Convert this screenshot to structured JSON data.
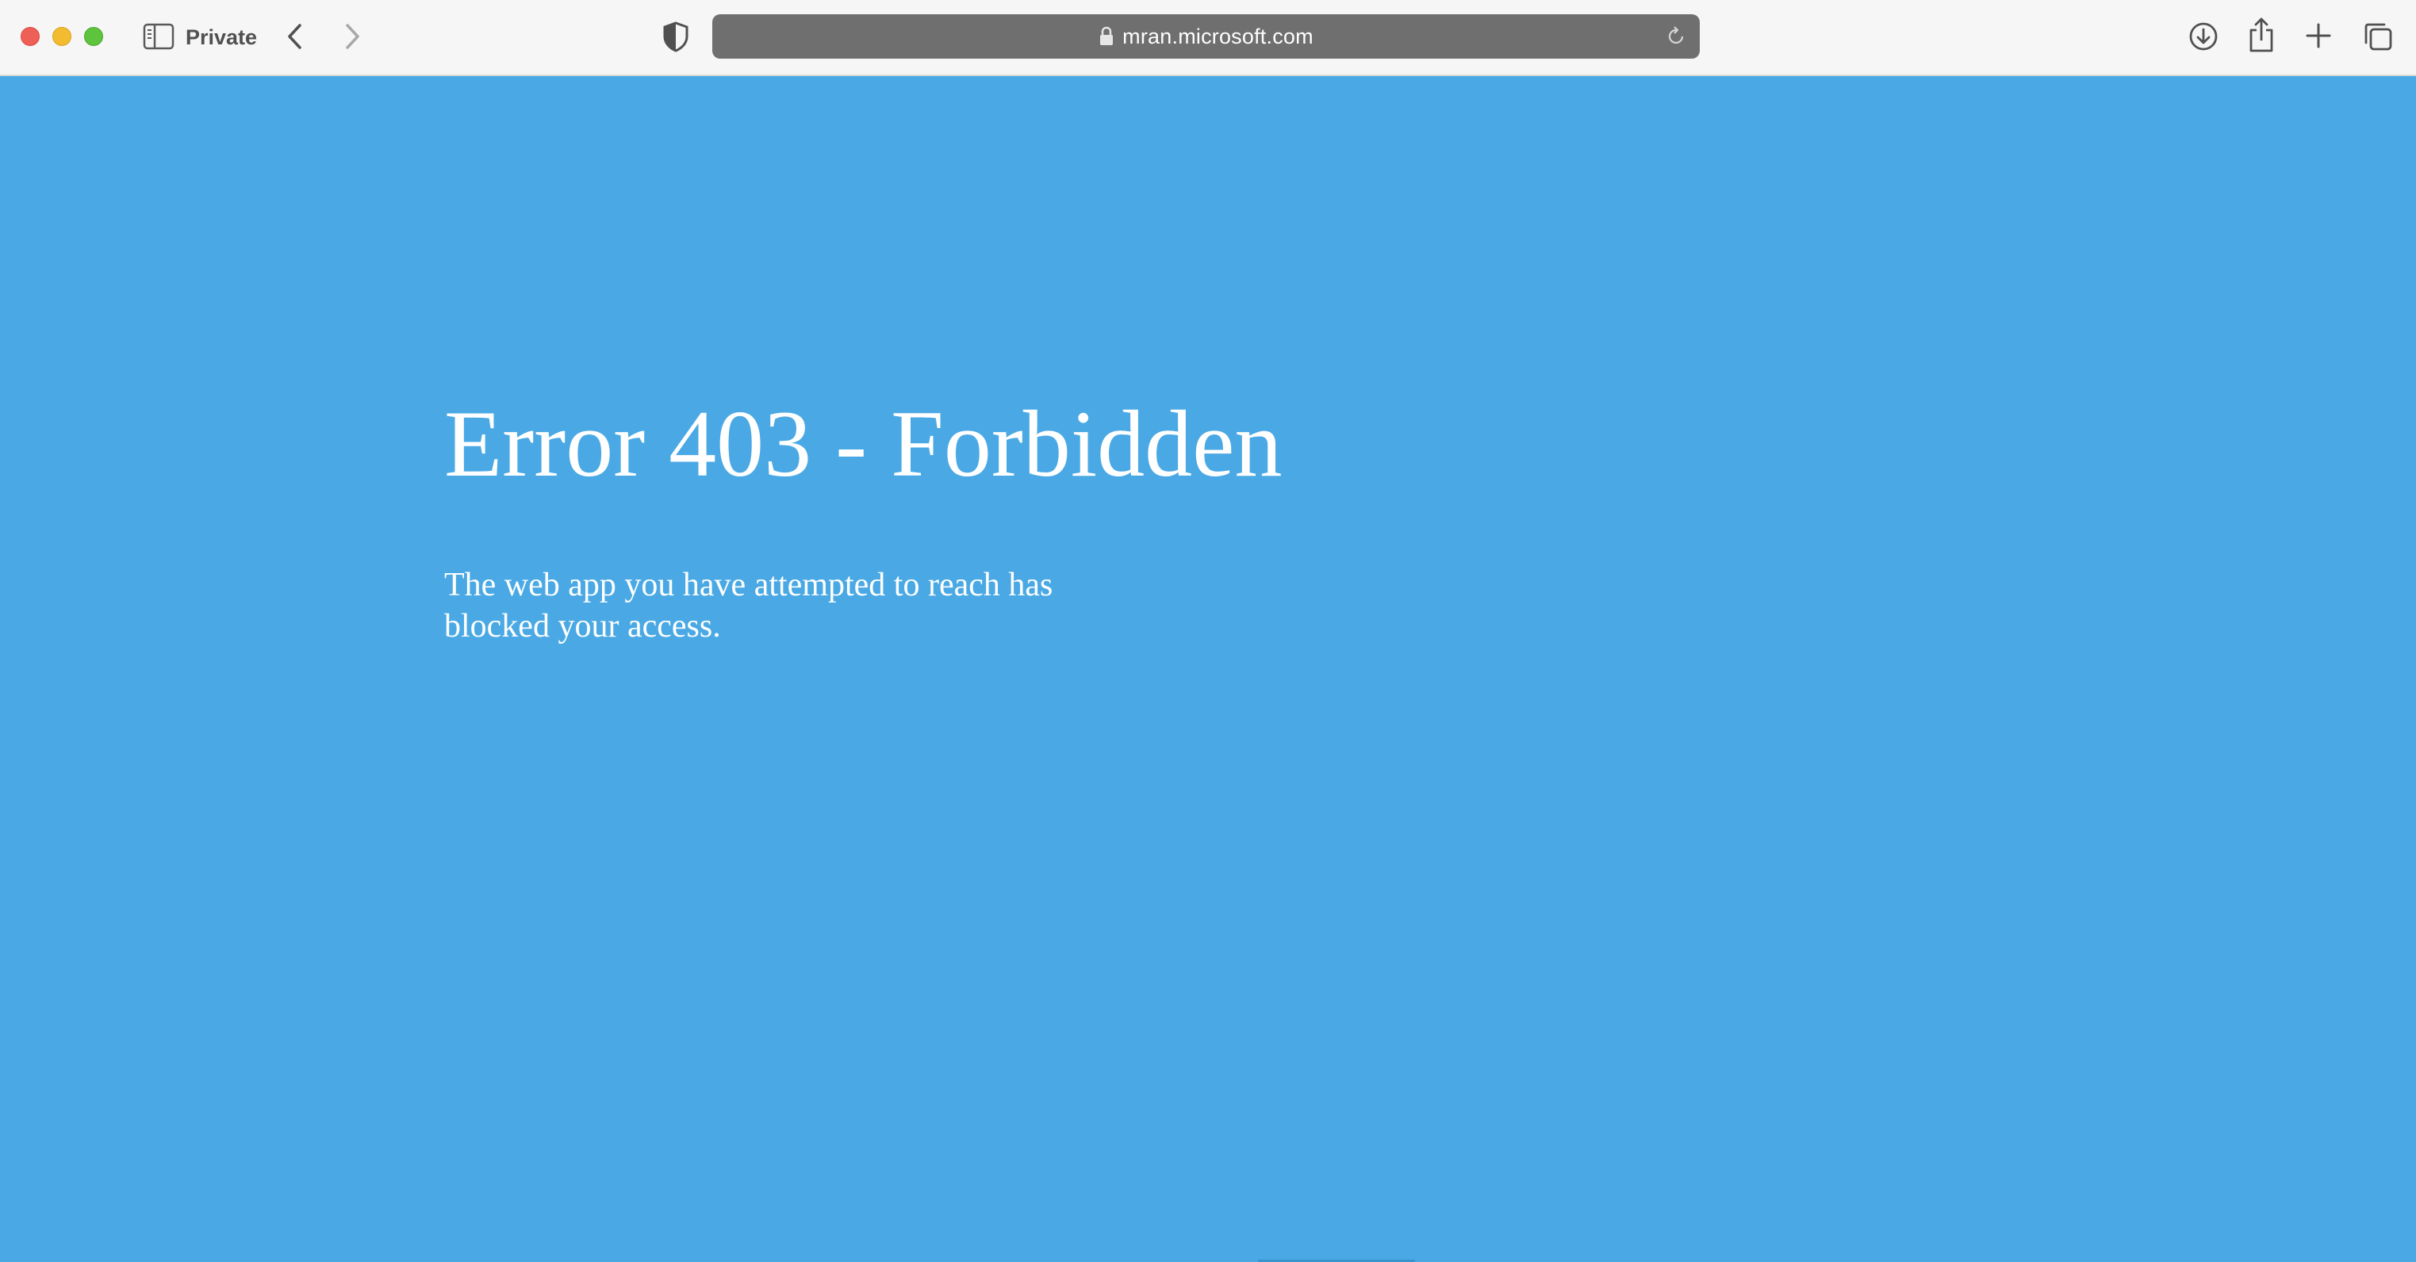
{
  "toolbar": {
    "private_label": "Private",
    "icons": {
      "sidebar": "sidebar-icon",
      "back": "chevron-left-icon",
      "forward": "chevron-right-icon",
      "privacy": "shield-icon",
      "lock": "lock-icon",
      "reload": "reload-icon",
      "download": "download-icon",
      "share": "share-icon",
      "new_tab": "plus-icon",
      "tab_overview": "tabs-icon"
    }
  },
  "address_bar": {
    "url": "mran.microsoft.com"
  },
  "page": {
    "title": "Error 403 - Forbidden",
    "message": "The web app you have attempted to reach has blocked your access."
  },
  "colors": {
    "page_background": "#4aa9e4",
    "toolbar_background": "#f6f6f6",
    "address_bar_background": "#6f6f70",
    "close": "#ee5f57",
    "minimize": "#f3bc30",
    "maximize": "#5ec43e"
  }
}
